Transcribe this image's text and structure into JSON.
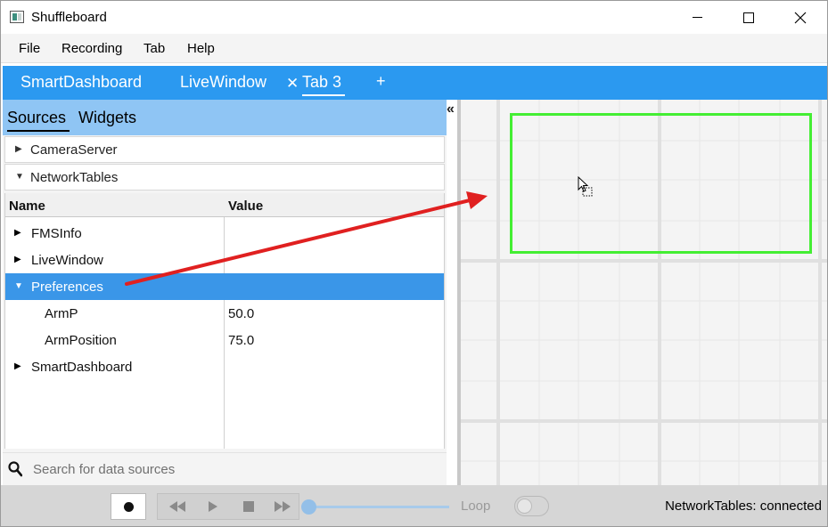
{
  "window": {
    "title": "Shuffleboard",
    "minimize_icon": "minimize-icon",
    "maximize_icon": "maximize-icon",
    "close_icon": "close-icon"
  },
  "menu": {
    "items": [
      {
        "label": "File"
      },
      {
        "label": "Recording"
      },
      {
        "label": "Tab"
      },
      {
        "label": "Help"
      }
    ]
  },
  "tabs": {
    "items": [
      {
        "label": "SmartDashboard"
      },
      {
        "label": "LiveWindow"
      },
      {
        "label": "Tab 3",
        "selected": true
      }
    ],
    "close_glyph": "✕",
    "add_glyph": "+",
    "accent_color": "#2b99f0"
  },
  "sources_panel": {
    "tabs": [
      {
        "label": "Sources",
        "selected": true
      },
      {
        "label": "Widgets"
      }
    ],
    "sections": [
      {
        "label": "CameraServer",
        "expanded": false
      },
      {
        "label": "NetworkTables",
        "expanded": true
      }
    ],
    "table": {
      "columns": [
        "Name",
        "Value"
      ],
      "rows": [
        {
          "name": "FMSInfo",
          "value": "",
          "expandable": true,
          "expanded": false,
          "indent": 0
        },
        {
          "name": "LiveWindow",
          "value": "",
          "expandable": true,
          "expanded": false,
          "indent": 0
        },
        {
          "name": "Preferences",
          "value": "",
          "expandable": true,
          "expanded": true,
          "indent": 0,
          "selected": true
        },
        {
          "name": "ArmP",
          "value": "50.0",
          "expandable": false,
          "indent": 1
        },
        {
          "name": "ArmPosition",
          "value": "75.0",
          "expandable": false,
          "indent": 1
        },
        {
          "name": "SmartDashboard",
          "value": "",
          "expandable": true,
          "expanded": false,
          "indent": 0
        }
      ],
      "selection_color": "#3a96e8"
    },
    "search": {
      "placeholder": "Search for data sources",
      "value": ""
    },
    "header_color": "#8fc5f4"
  },
  "grid": {
    "drop_target_color": "#44ee33"
  },
  "annotation": {
    "arrow_color": "#e02020"
  },
  "playback": {
    "loop_label": "Loop",
    "loop_enabled": false,
    "position": 0
  },
  "status": {
    "text": "NetworkTables: connected"
  }
}
